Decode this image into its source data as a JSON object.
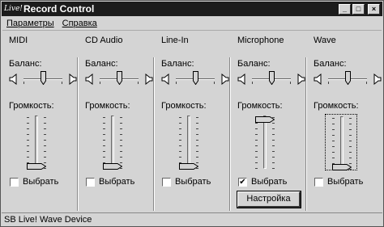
{
  "window": {
    "title": "Record Control",
    "app_icon_text": "Live!"
  },
  "menu": [
    {
      "label": "Параметры"
    },
    {
      "label": "Справка"
    }
  ],
  "labels": {
    "balance": "Баланс:",
    "volume": "Громкость:",
    "select": "Выбрать"
  },
  "channels": [
    {
      "name": "MIDI",
      "selected": false,
      "volume_level": 0.0,
      "balance": 0.5
    },
    {
      "name": "CD Audio",
      "selected": false,
      "volume_level": 0.0,
      "balance": 0.5
    },
    {
      "name": "Line-In",
      "selected": false,
      "volume_level": 0.0,
      "balance": 0.5
    },
    {
      "name": "Microphone",
      "selected": true,
      "volume_level": 1.0,
      "balance": 0.5,
      "settings_label": "Настройка"
    },
    {
      "name": "Wave",
      "selected": false,
      "volume_level": 0.0,
      "balance": 0.5,
      "focused": true
    }
  ],
  "status": {
    "text": "SB Live! Wave Device"
  }
}
